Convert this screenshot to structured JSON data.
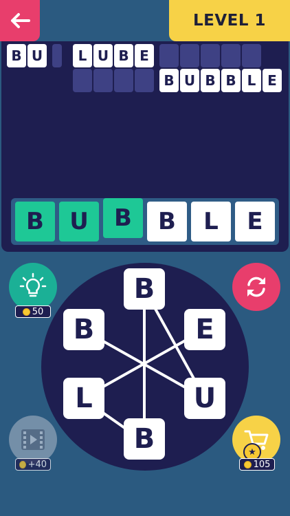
{
  "header": {
    "level_label": "LEVEL 1"
  },
  "grid": {
    "rows": [
      [
        {
          "letter": "B",
          "state": "filled"
        },
        {
          "letter": "U",
          "state": "filled"
        },
        {
          "letter": "",
          "state": "empty"
        },
        {
          "letter": "",
          "state": "gap"
        },
        {
          "letter": "L",
          "state": "filled"
        },
        {
          "letter": "U",
          "state": "filled"
        },
        {
          "letter": "B",
          "state": "filled"
        },
        {
          "letter": "E",
          "state": "filled"
        },
        {
          "letter": "",
          "state": "empty"
        },
        {
          "letter": "",
          "state": "empty"
        },
        {
          "letter": "",
          "state": "empty"
        },
        {
          "letter": "",
          "state": "empty"
        },
        {
          "letter": "",
          "state": "empty"
        }
      ],
      [
        {
          "letter": "",
          "state": "empty"
        },
        {
          "letter": "",
          "state": "empty"
        },
        {
          "letter": "",
          "state": "empty"
        },
        {
          "letter": "",
          "state": "empty"
        },
        {
          "letter": "B",
          "state": "filled"
        },
        {
          "letter": "U",
          "state": "filled"
        },
        {
          "letter": "B",
          "state": "filled"
        },
        {
          "letter": "B",
          "state": "filled"
        },
        {
          "letter": "L",
          "state": "filled"
        },
        {
          "letter": "E",
          "state": "filled"
        }
      ]
    ]
  },
  "answer": {
    "tiles": [
      {
        "letter": "B",
        "state": "found"
      },
      {
        "letter": "U",
        "state": "found"
      },
      {
        "letter": "B",
        "state": "found"
      },
      {
        "letter": "B",
        "state": "pending"
      },
      {
        "letter": "L",
        "state": "pending"
      },
      {
        "letter": "E",
        "state": "pending"
      }
    ]
  },
  "wheel": {
    "letters": [
      "B",
      "E",
      "U",
      "B",
      "L",
      "B"
    ]
  },
  "buttons": {
    "hint": {
      "icon": "lightbulb-icon",
      "price": "50"
    },
    "shuffle": {
      "icon": "refresh-icon"
    },
    "video": {
      "icon": "film-icon",
      "price": "+40"
    },
    "shop": {
      "icon": "cart-icon",
      "price": "105"
    }
  },
  "colors": {
    "background": "#2b5a80",
    "board": "#1e1e50",
    "accent_pink": "#e83e6c",
    "accent_yellow": "#f7d247",
    "found_green": "#1ec896",
    "hint_teal": "#1bb096"
  }
}
